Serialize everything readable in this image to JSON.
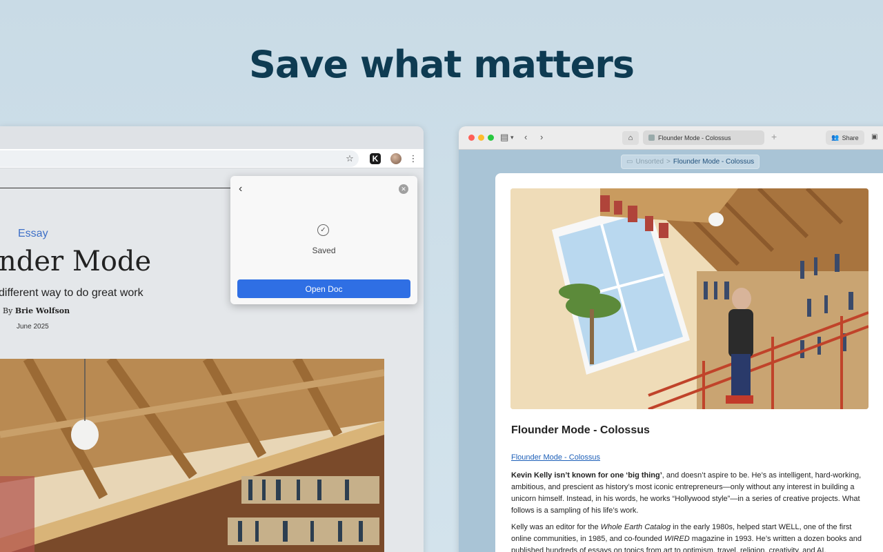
{
  "headline": "Save what matters",
  "left_article": {
    "category": "Essay",
    "title": "nder Mode",
    "subtitle": "different way to do great work",
    "byline_prefix": "By",
    "author": "Brie Wolfson",
    "date": "June 2025"
  },
  "popup": {
    "status": "Saved",
    "button_label": "Open Doc"
  },
  "right_window": {
    "tab_title": "Flounder Mode - Colossus",
    "share_label": "Share",
    "breadcrumb": {
      "folder": "Unsorted",
      "separator": ">",
      "current": "Flounder Mode - Colossus"
    },
    "doc": {
      "title": "Flounder Mode - Colossus",
      "link": "Flounder Mode - Colossus",
      "p1_bold": "Kevin Kelly isn’t known for one ‘big thing’",
      "p1_rest": ", and doesn’t aspire to be. He’s as intelligent, hard-working, ambitious, and prescient as history’s most iconic entrepreneurs—only without any interest in building a unicorn himself. Instead, in his words, he works “Hollywood style”—in a series of creative projects. What follows is a sampling of his life’s work.",
      "p2_a": "Kelly was an editor for the ",
      "p2_italic1": "Whole Earth Catalog",
      "p2_b": " in the early 1980s, helped start WELL, one of the first online communities, in 1985, and co-founded ",
      "p2_italic2": "WIRED",
      "p2_c": " magazine in 1993. He’s written a dozen books and published hundreds of essays on topics from art to optimism, travel, religion, creativity, and AI."
    }
  },
  "colors": {
    "headline": "#0e3b52",
    "accent_button": "#2f6fe4",
    "essay_blue": "#3d6fc7",
    "link_blue": "#1d5fb8"
  }
}
